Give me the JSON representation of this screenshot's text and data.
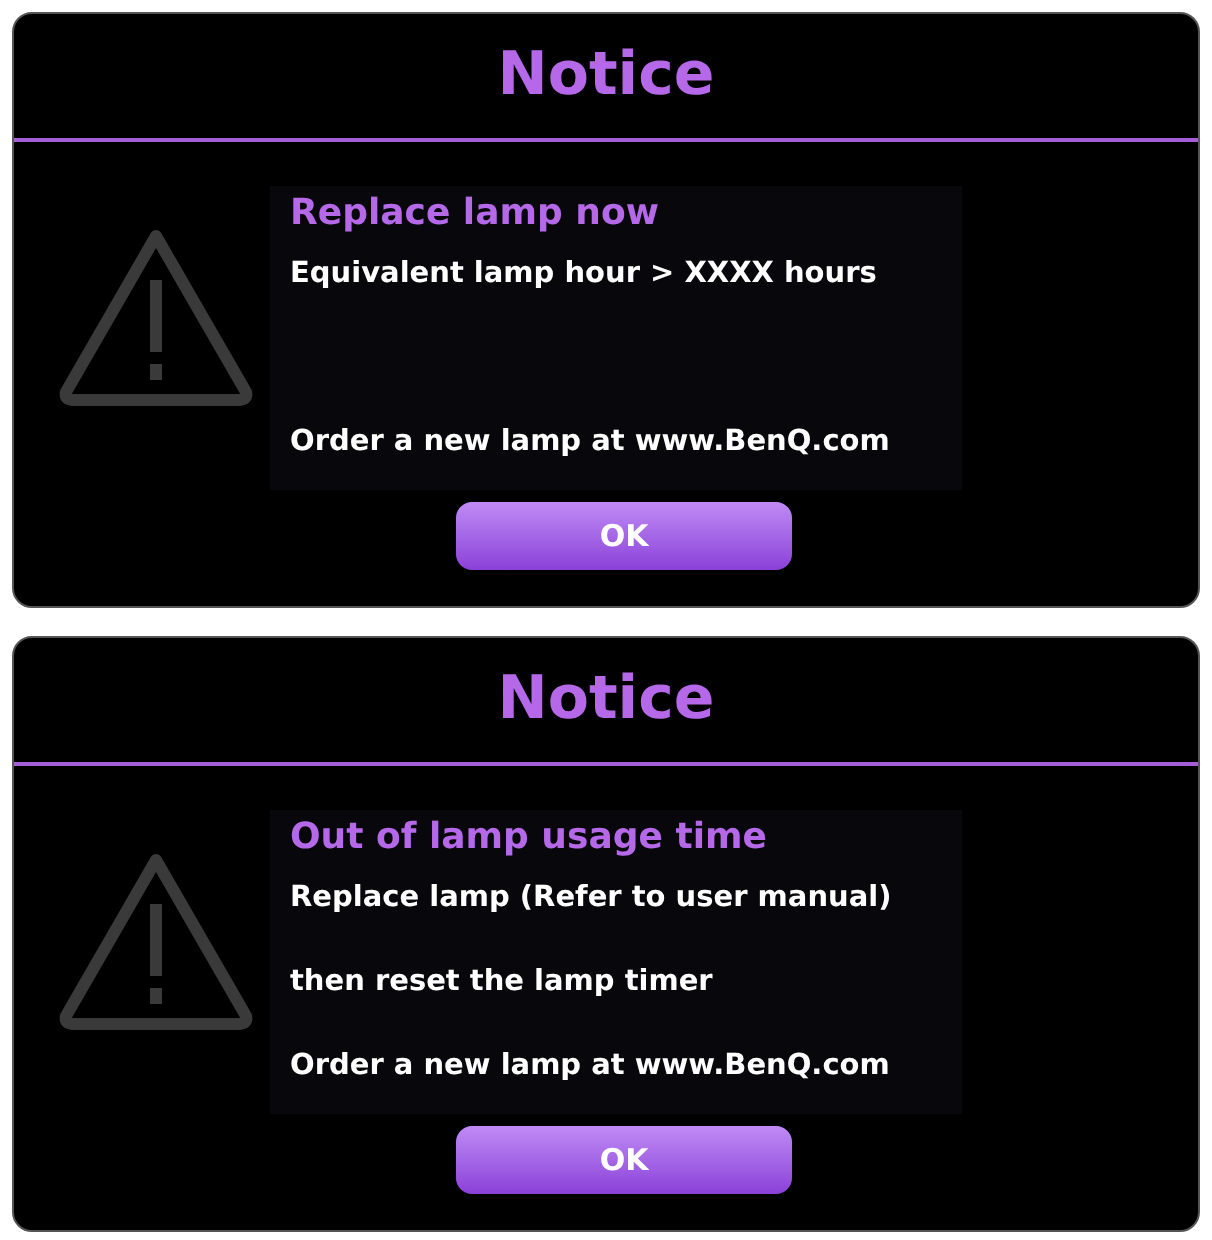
{
  "dialogs": [
    {
      "title": "Notice",
      "heading": "Replace lamp now",
      "lines": [
        "Equivalent lamp hour > XXXX hours",
        "Order a new lamp at www.BenQ.com"
      ],
      "button": "OK"
    },
    {
      "title": "Notice",
      "heading": "Out of lamp usage time",
      "lines": [
        "Replace lamp (Refer to user manual)",
        "then reset the lamp timer",
        "Order a new lamp at www.BenQ.com"
      ],
      "button": "OK"
    }
  ]
}
